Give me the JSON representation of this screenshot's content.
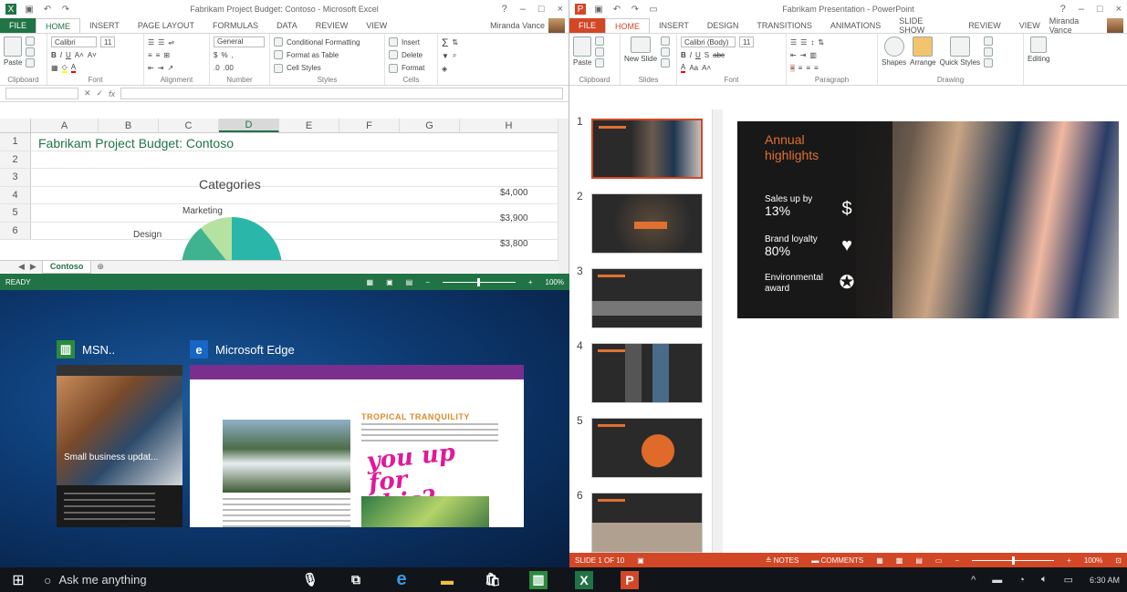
{
  "excel": {
    "title": "Fabrikam Project Budget: Contoso - Microsoft Excel",
    "tabs": [
      {
        "label": "FILE"
      },
      {
        "label": "HOME"
      },
      {
        "label": "INSERT"
      },
      {
        "label": "PAGE LAYOUT"
      },
      {
        "label": "FORMULAS"
      },
      {
        "label": "DATA"
      },
      {
        "label": "REVIEW"
      },
      {
        "label": "VIEW"
      }
    ],
    "user": "Miranda Vance",
    "ribbon": {
      "paste": "Paste",
      "font": "Calibri",
      "font_size": "11",
      "number_format": "General",
      "conditional": "Conditional Formatting",
      "format_table": "Format as Table",
      "cell_styles": "Cell Styles",
      "insert": "Insert",
      "delete": "Delete",
      "format": "Format",
      "groups": [
        "Clipboard",
        "Font",
        "Alignment",
        "Number",
        "Styles",
        "Cells"
      ]
    },
    "columns": [
      "A",
      "B",
      "C",
      "D",
      "E",
      "F",
      "G",
      "H"
    ],
    "rows": [
      "1",
      "2",
      "3",
      "4",
      "5",
      "6"
    ],
    "sheet_title": "Fabrikam Project Budget: Contoso",
    "chart": {
      "title": "Categories",
      "labels": [
        "Marketing",
        "Design"
      ]
    },
    "y_values": [
      "$4,000",
      "$3,900",
      "$3,800"
    ],
    "sheet_tab": "Contoso",
    "status": "READY",
    "zoom": "100%"
  },
  "desktop": {
    "apps": [
      {
        "name": "MSN..",
        "thumb_title": "Small business updat..."
      },
      {
        "name": "Microsoft Edge",
        "page_title": "TROPICAL TRANQUILITY",
        "ink": "you up for this?"
      }
    ]
  },
  "ppt": {
    "title": "Fabrikam Presentation - PowerPoint",
    "tabs": [
      {
        "label": "FILE"
      },
      {
        "label": "HOME"
      },
      {
        "label": "INSERT"
      },
      {
        "label": "DESIGN"
      },
      {
        "label": "TRANSITIONS"
      },
      {
        "label": "ANIMATIONS"
      },
      {
        "label": "SLIDE SHOW"
      },
      {
        "label": "REVIEW"
      },
      {
        "label": "VIEW"
      }
    ],
    "user": "Miranda Vance",
    "ribbon": {
      "paste": "Paste",
      "new_slide": "New Slide",
      "font": "Calibri (Body)",
      "font_size": "11",
      "shapes": "Shapes",
      "arrange": "Arrange",
      "quick_styles": "Quick Styles",
      "editing": "Editing",
      "groups": [
        "Clipboard",
        "Slides",
        "Font",
        "Paragraph",
        "Drawing"
      ]
    },
    "slides": [
      "1",
      "2",
      "3",
      "4",
      "5",
      "6"
    ],
    "main_slide": {
      "title": "Annual highlights",
      "stats": [
        {
          "label": "Sales up by",
          "value": "13%"
        },
        {
          "label": "Brand loyalty",
          "value": "80%"
        },
        {
          "label": "Environmental award",
          "value": ""
        }
      ]
    },
    "status": {
      "slide": "SLIDE 1 OF 10",
      "notes": "NOTES",
      "comments": "COMMENTS",
      "zoom": "100%"
    }
  },
  "taskbar": {
    "search_placeholder": "Ask me anything",
    "time": "6:30 AM"
  },
  "colors": {
    "excel_green": "#217346",
    "ppt_orange": "#d24726",
    "accent_orange": "#e07030"
  }
}
